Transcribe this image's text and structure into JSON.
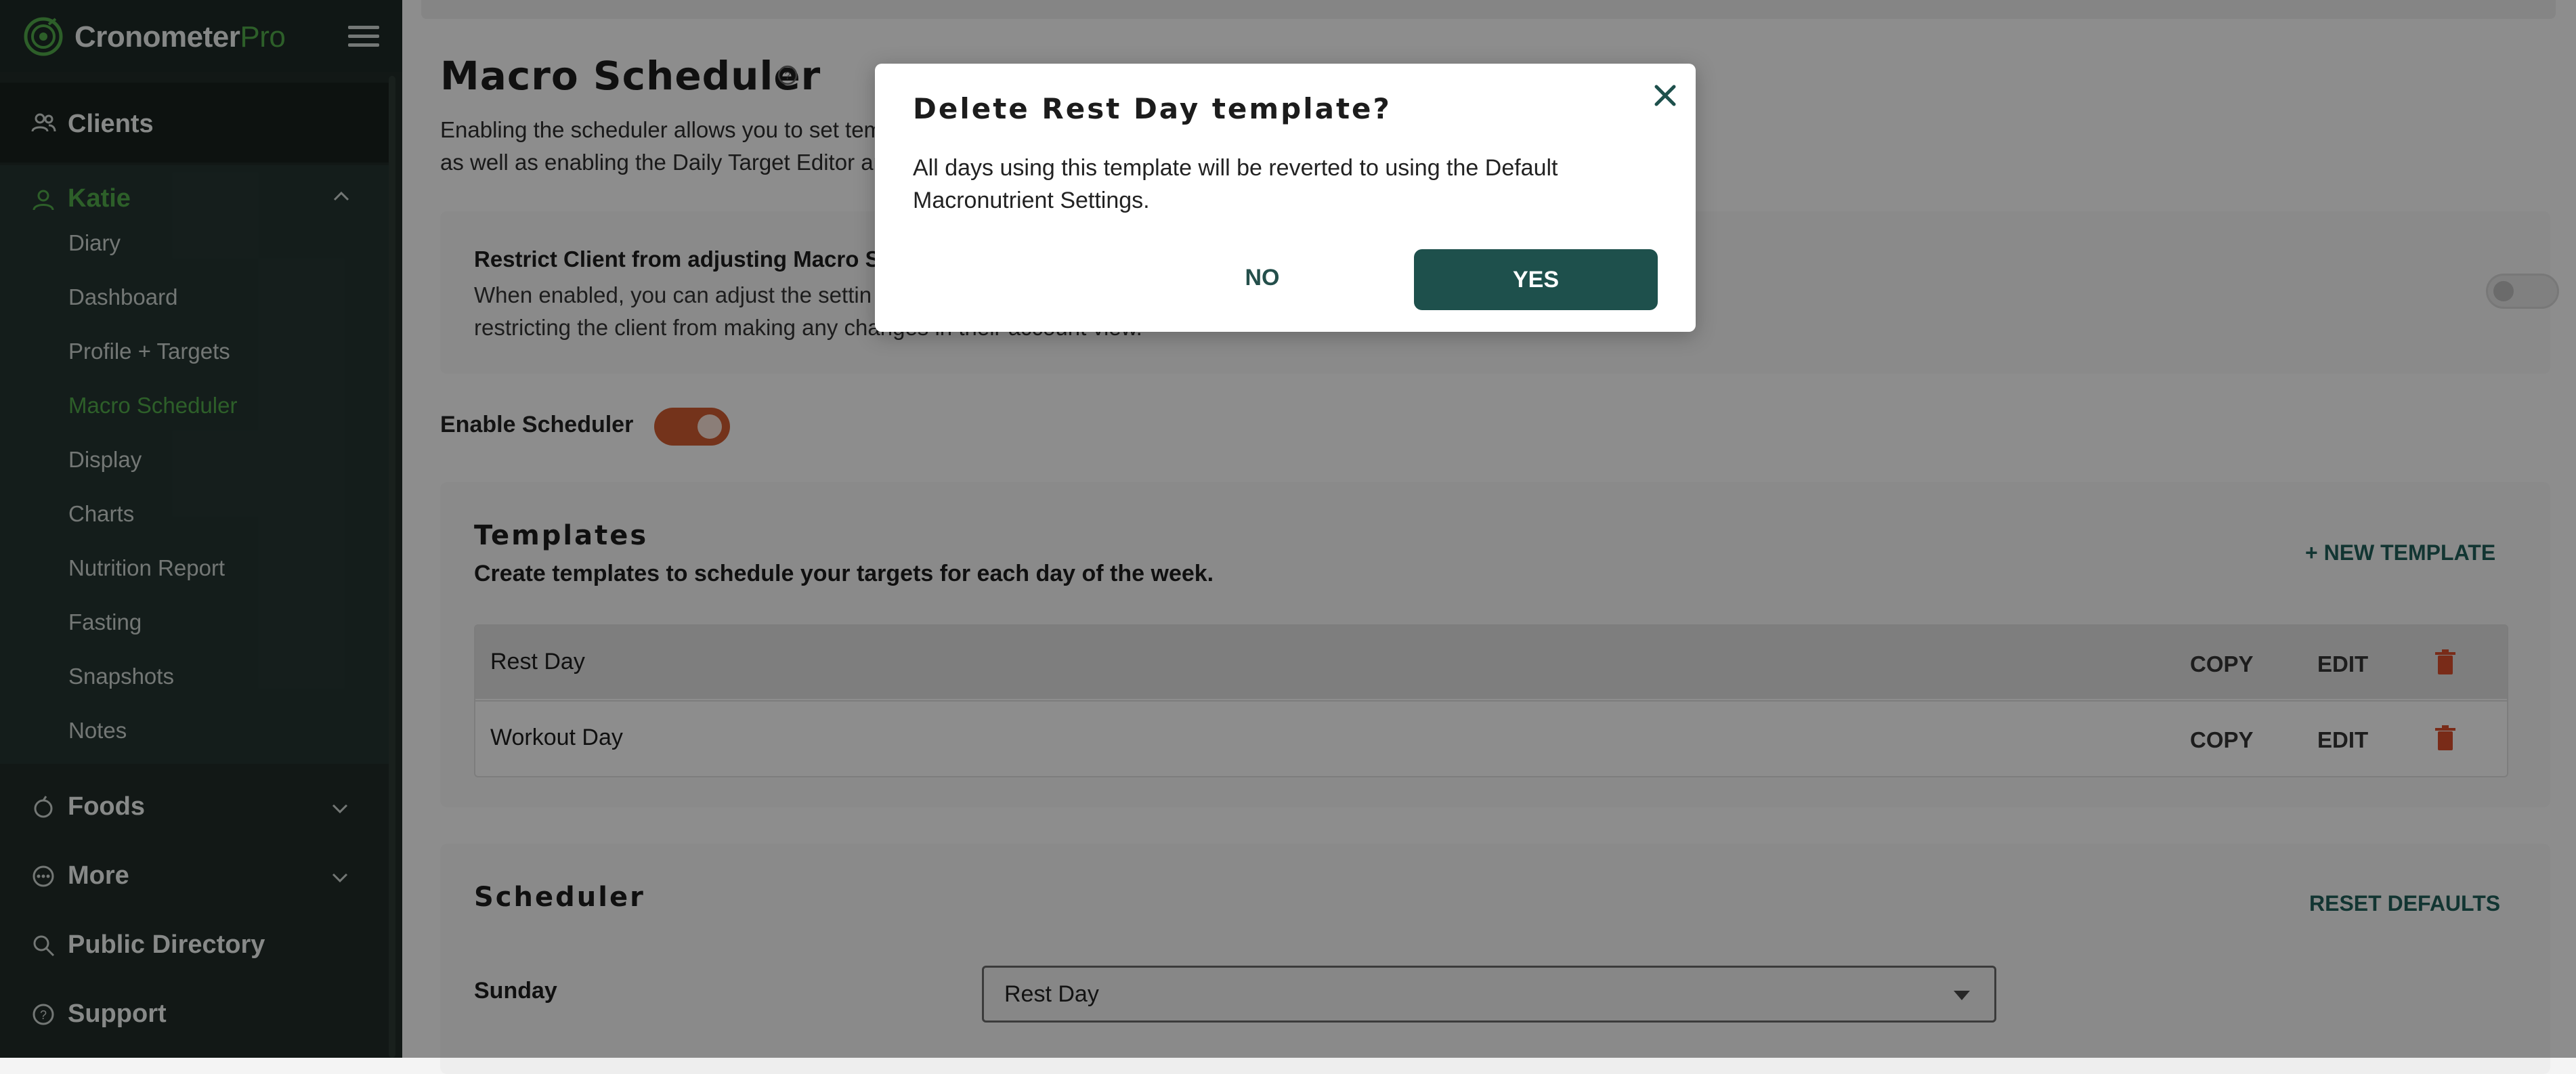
{
  "app": {
    "logo_main": "Cronometer",
    "logo_pro": "Pro"
  },
  "sidebar": {
    "clients": "Clients",
    "client_name": "Katie",
    "sub_items": [
      "Diary",
      "Dashboard",
      "Profile + Targets",
      "Macro Scheduler",
      "Display",
      "Charts",
      "Nutrition Report",
      "Fasting",
      "Snapshots",
      "Notes"
    ],
    "active_sub": "Macro Scheduler",
    "foods": "Foods",
    "more": "More",
    "public_directory": "Public Directory",
    "support": "Support"
  },
  "page": {
    "title": "Macro Scheduler",
    "intro_line1": "Enabling the scheduler allows you to set tem",
    "intro_line2": "as well as enabling the Daily Target Editor an"
  },
  "restrict": {
    "title": "Restrict Client from adjusting Macro Sc",
    "desc_line1": "When enabled, you can adjust the settin",
    "desc_line2": "restricting the client from making any changes in their account view."
  },
  "scheduler_toggle": {
    "label": "Enable Scheduler",
    "enabled": true
  },
  "templates": {
    "title": "Templates",
    "subtitle": "Create templates to schedule your targets for each day of the week.",
    "new_button": "+ NEW TEMPLATE",
    "rows": [
      {
        "name": "Rest Day",
        "copy": "COPY",
        "edit": "EDIT"
      },
      {
        "name": "Workout Day",
        "copy": "COPY",
        "edit": "EDIT"
      }
    ]
  },
  "scheduler": {
    "title": "Scheduler",
    "reset_button": "RESET DEFAULTS",
    "day": "Sunday",
    "selected_template": "Rest Day"
  },
  "modal": {
    "title": "Delete Rest Day template?",
    "body": "All days using this template will be reverted to using the Default Macronutrient Settings.",
    "no": "NO",
    "yes": "YES"
  },
  "colors": {
    "brand_green": "#4fa447",
    "primary_teal": "#1e504c",
    "toggle_orange": "#c8592f",
    "trash_red": "#d04a2a",
    "sidebar_bg": "#1f2a26"
  }
}
